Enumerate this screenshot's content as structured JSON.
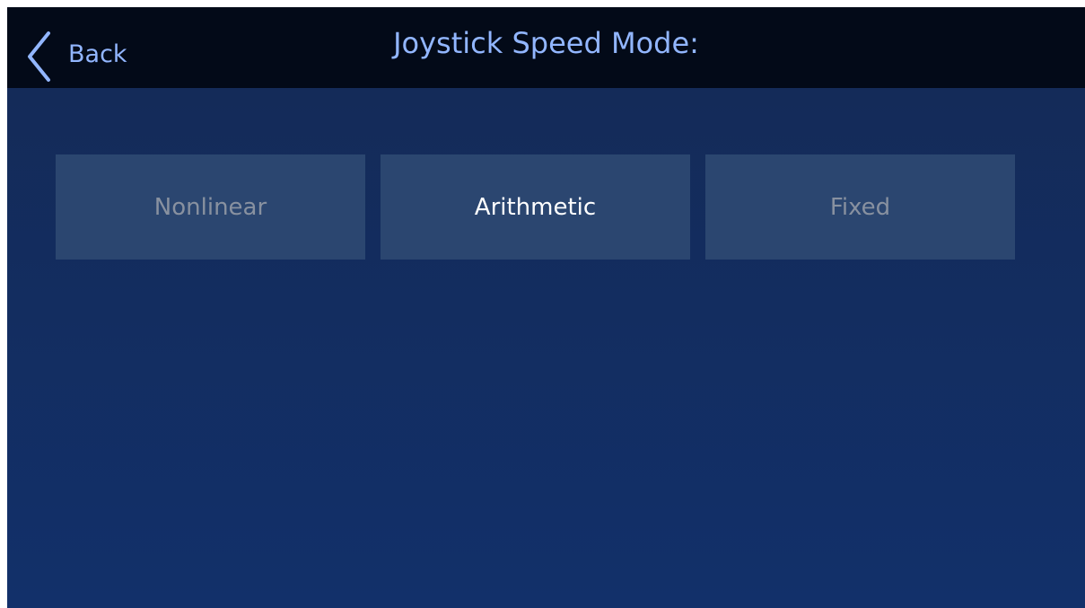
{
  "header": {
    "back_label": "Back",
    "title": "Joystick Speed Mode:"
  },
  "options": [
    {
      "label": "Nonlinear",
      "selected": false
    },
    {
      "label": "Arithmetic",
      "selected": true
    },
    {
      "label": "Fixed",
      "selected": false
    }
  ],
  "colors": {
    "header_bg": "#030a18",
    "accent_text": "#92b6ff",
    "option_bg": "#2b4670",
    "option_text": "#8891a0",
    "option_selected_text": "#ffffff"
  }
}
